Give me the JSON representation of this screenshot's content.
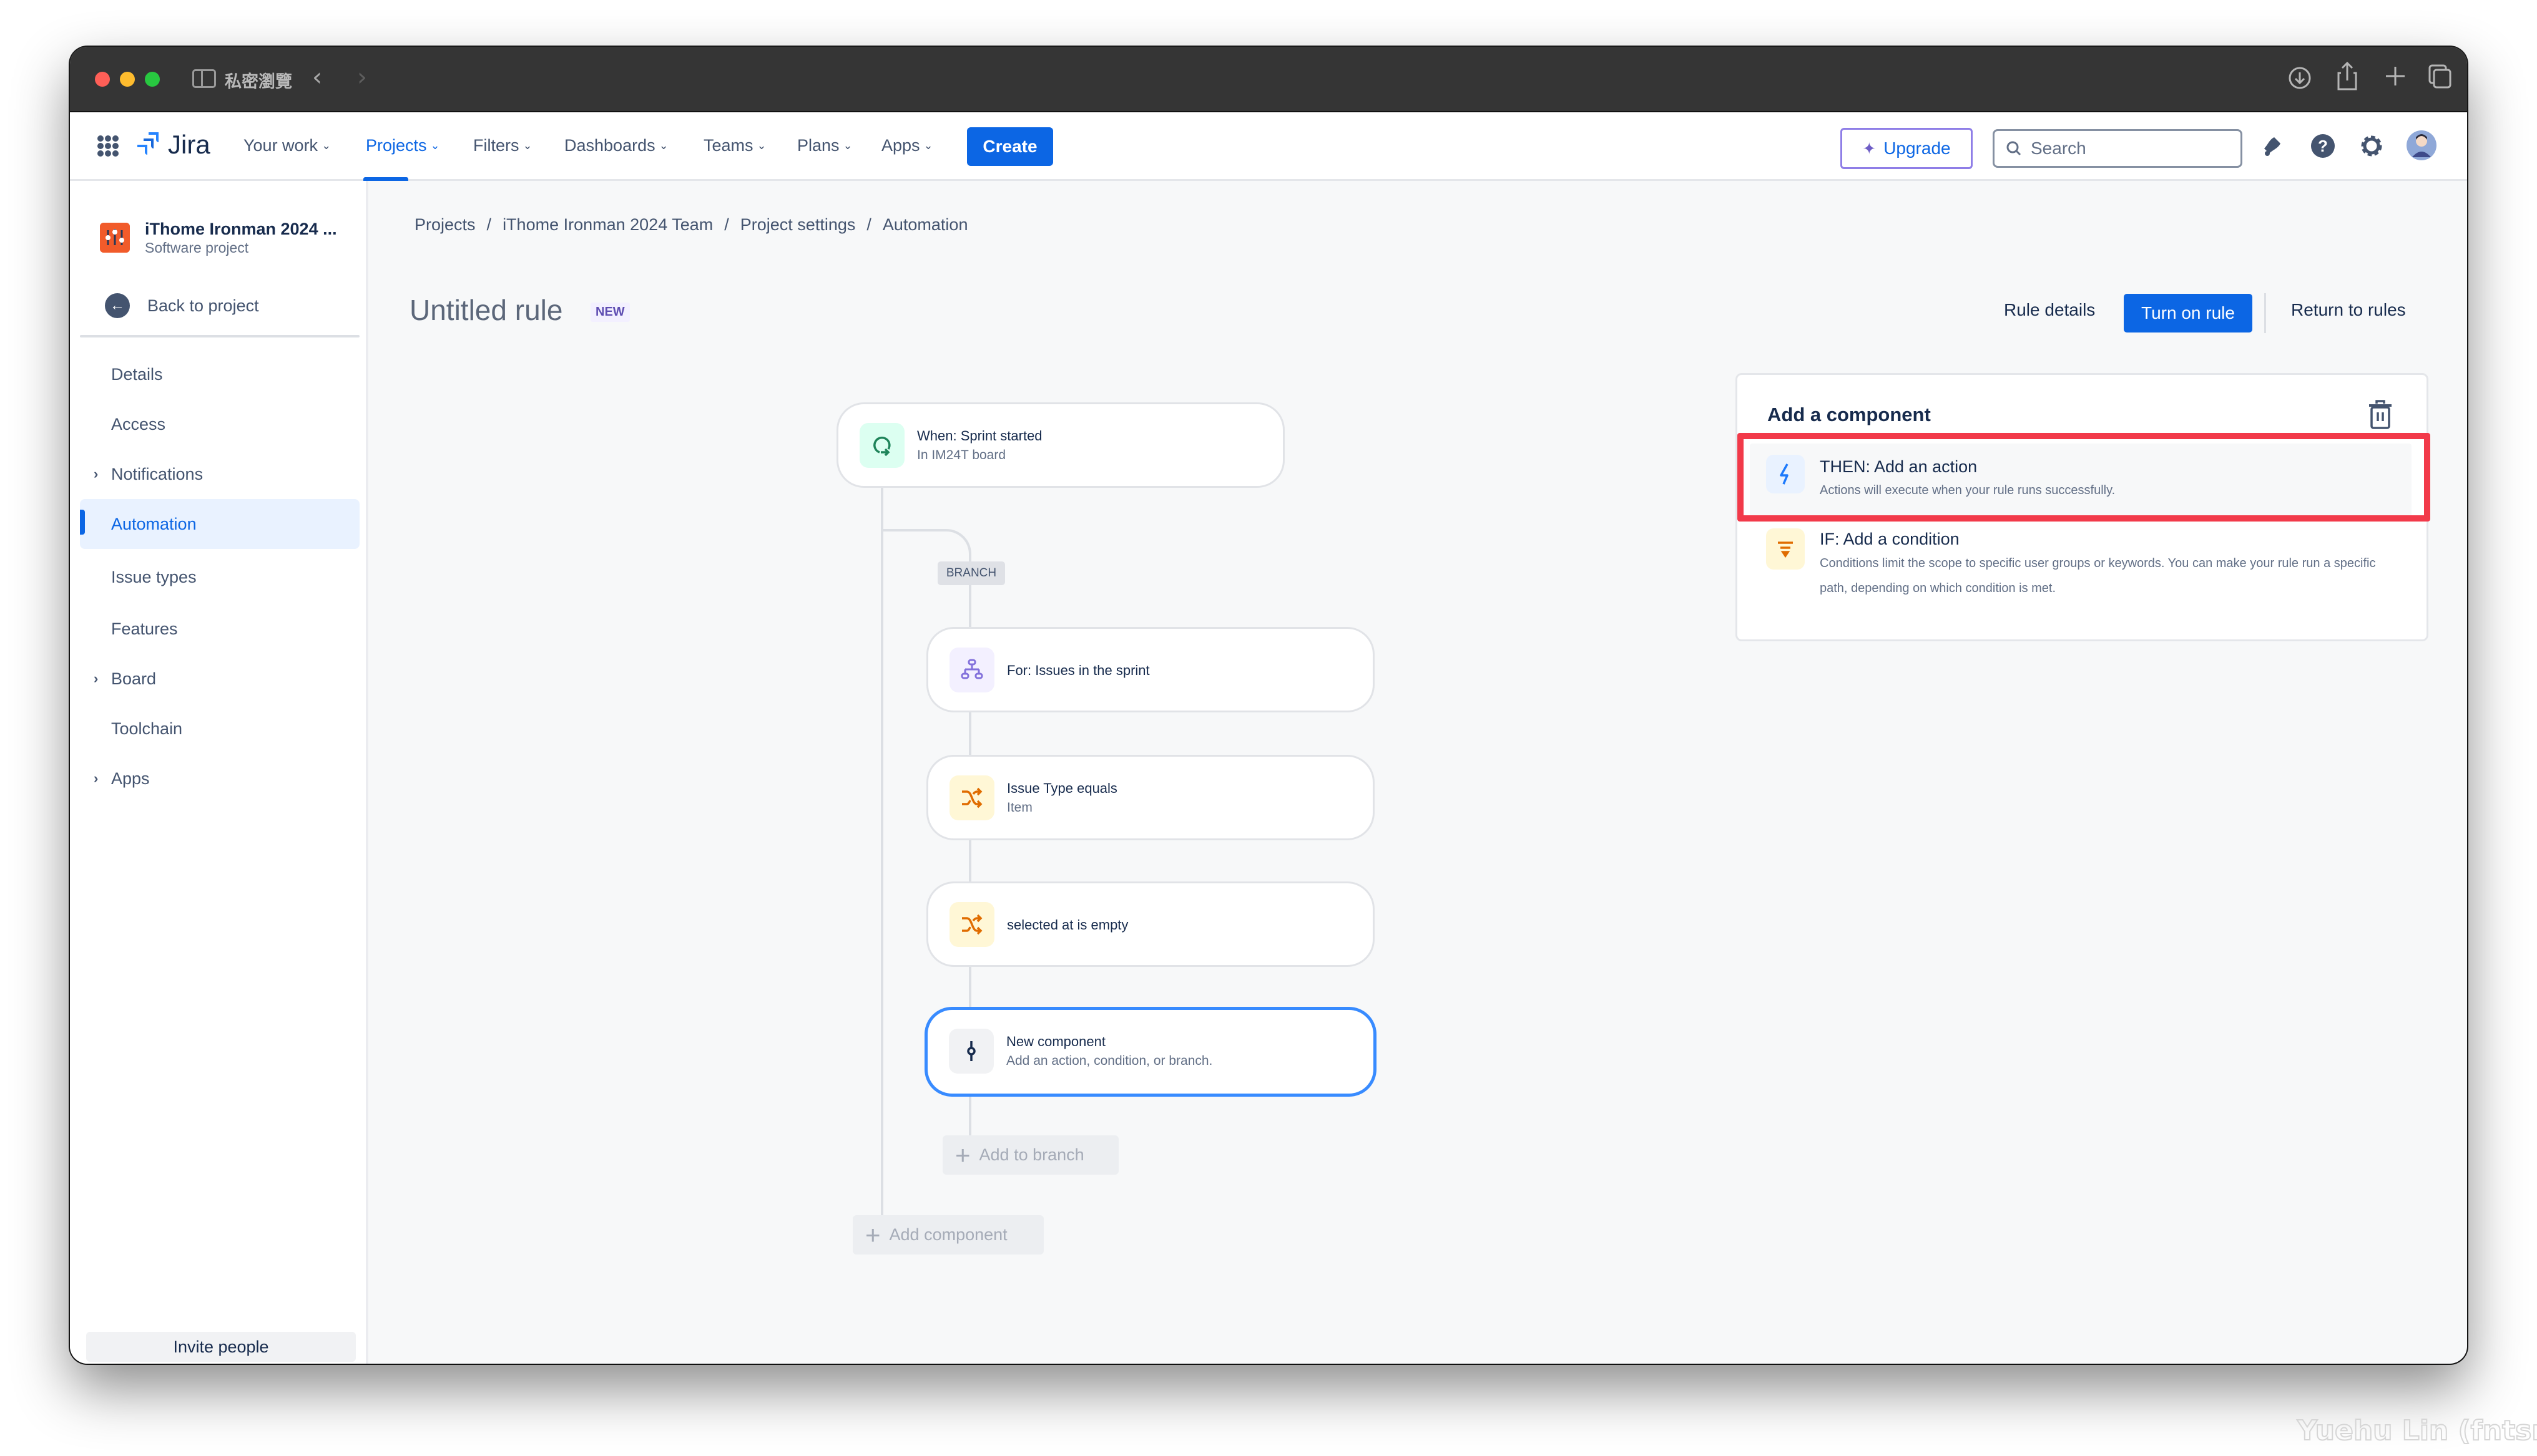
{
  "browser": {
    "title": "私密瀏覽",
    "back_glyph": "‹",
    "forward_glyph": "›",
    "icons": [
      "download-icon",
      "share-icon",
      "new-tab-icon",
      "tabs-overview-icon"
    ]
  },
  "topnav": {
    "product": "Jira",
    "items": [
      {
        "label": "Your work",
        "active": false
      },
      {
        "label": "Projects",
        "active": true
      },
      {
        "label": "Filters",
        "active": false
      },
      {
        "label": "Dashboards",
        "active": false
      },
      {
        "label": "Teams",
        "active": false
      },
      {
        "label": "Plans",
        "active": false
      },
      {
        "label": "Apps",
        "active": false
      }
    ],
    "chevron": "⌄",
    "create_label": "Create",
    "upgrade_label": "Upgrade",
    "search_placeholder": "Search",
    "accent_color": "#0c66e4"
  },
  "sidebar": {
    "project_name": "iThome Ironman 2024 ...",
    "project_type": "Software project",
    "back_label": "Back to project",
    "items": [
      {
        "label": "Details",
        "expandable": false,
        "active": false
      },
      {
        "label": "Access",
        "expandable": false,
        "active": false
      },
      {
        "label": "Notifications",
        "expandable": true,
        "active": false
      },
      {
        "label": "Automation",
        "expandable": false,
        "active": true
      },
      {
        "label": "Issue types",
        "expandable": false,
        "active": false
      },
      {
        "label": "Features",
        "expandable": false,
        "active": false
      },
      {
        "label": "Board",
        "expandable": true,
        "active": false
      },
      {
        "label": "Toolchain",
        "expandable": false,
        "active": false
      },
      {
        "label": "Apps",
        "expandable": true,
        "active": false
      }
    ],
    "expander_glyph": "›",
    "invite_label": "Invite people"
  },
  "breadcrumb": [
    "Projects",
    "iThome Ironman 2024 Team",
    "Project settings",
    "Automation"
  ],
  "breadcrumb_sep": "/",
  "header": {
    "title": "Untitled rule",
    "badge": "NEW",
    "rule_details": "Rule details",
    "turn_on": "Turn on rule",
    "return": "Return to rules"
  },
  "canvas": {
    "trigger": {
      "title": "When: Sprint started",
      "subtitle": "In IM24T board",
      "icon": "sprint-cycle-icon"
    },
    "branch_label": "BRANCH",
    "branch_cards": [
      {
        "title": "For: Issues in the sprint",
        "subtitle": "",
        "icon": "branch-hierarchy-icon"
      },
      {
        "title": "Issue Type equals",
        "subtitle": "Item",
        "icon": "condition-shuffle-icon"
      },
      {
        "title": "selected at is empty",
        "subtitle": "",
        "icon": "condition-shuffle-icon"
      },
      {
        "title": "New component",
        "subtitle": "Add an action, condition, or branch.",
        "icon": "new-component-icon",
        "selected": true
      }
    ],
    "add_to_branch": "Add to branch",
    "add_component": "Add component"
  },
  "panel": {
    "title": "Add a component",
    "options": [
      {
        "title": "THEN: Add an action",
        "description": "Actions will execute when your rule runs successfully.",
        "icon": "lightning-icon",
        "highlighted": true
      },
      {
        "title": "IF: Add a condition",
        "description": "Conditions limit the scope to specific user groups or keywords. You can make your rule run a specific path, depending on which condition is met.",
        "icon": "filter-icon",
        "highlighted": false
      }
    ],
    "highlight_color": "#f23a4a"
  },
  "watermark": "Yuehu Lin (fntsr.tw)"
}
